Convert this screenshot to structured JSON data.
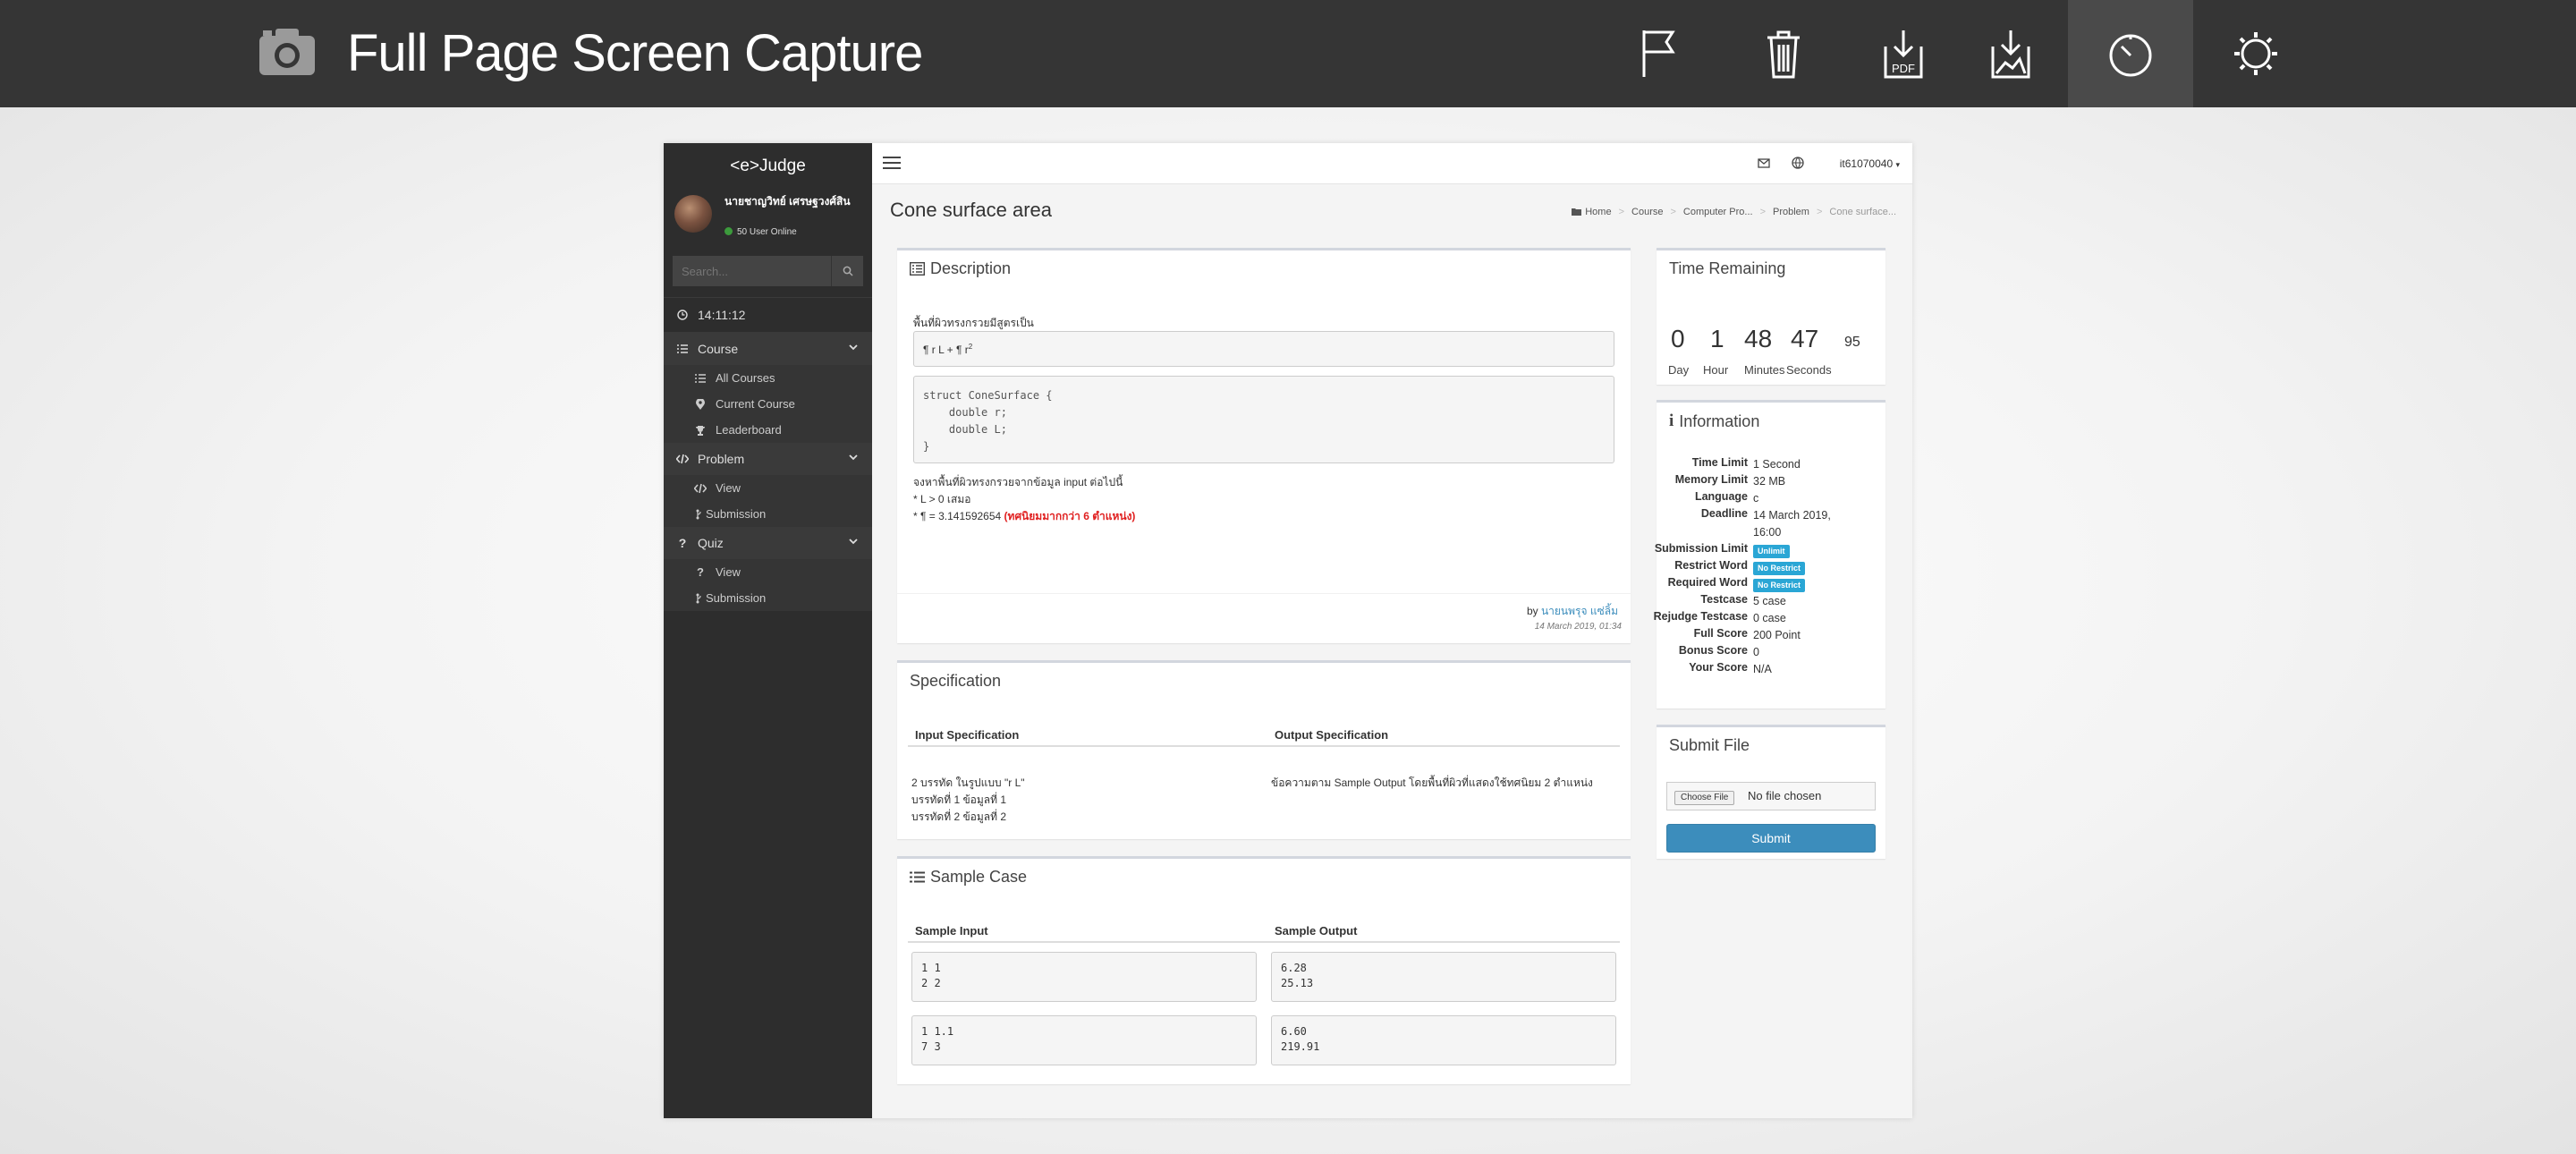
{
  "extension": {
    "title": "Full Page Screen Capture",
    "buttons": [
      "flag-icon",
      "trash-icon",
      "download-pdf-icon",
      "download-image-icon",
      "history-icon",
      "settings-icon"
    ],
    "pdf_label": "PDF"
  },
  "sidebar": {
    "brand": "<e>Judge",
    "user_name": "นายชาญวิทย์ เศรษฐวงศ์สิน",
    "online": "50 User Online",
    "search_placeholder": "Search...",
    "clock": "14:11:12",
    "sections": [
      {
        "label": "Course",
        "items": [
          "All Courses",
          "Current Course",
          "Leaderboard"
        ]
      },
      {
        "label": "Problem",
        "items": [
          "View",
          "Submission"
        ]
      },
      {
        "label": "Quiz",
        "items": [
          "View",
          "Submission"
        ]
      }
    ]
  },
  "header": {
    "user": "it61070040",
    "page_title": "Cone surface area",
    "breadcrumb": [
      "Home",
      "Course",
      "Computer Pro...",
      "Problem",
      "Cone surface..."
    ]
  },
  "description": {
    "title": "Description",
    "intro": "พื้นที่ผิวทรงกรวยมีสูตรเป็น",
    "formula": "¶ r L + ¶ r",
    "formula_sup": "2",
    "code": "struct ConeSurface {\n    double r;\n    double L;\n}",
    "note1": "จงหาพื้นที่ผิวทรงกรวยจากข้อมูล input ต่อไปนี้",
    "note2": "* L > 0 เสมอ",
    "note3": "* ¶ = 3.141592654 ",
    "note3_red": "(ทศนิยมมากกว่า 6 ตำแหน่ง)",
    "by_prefix": "by ",
    "author": "นายนพรุจ แซ่ลิ้ม",
    "date": "14 March 2019, 01:34"
  },
  "specification": {
    "title": "Specification",
    "input_header": "Input Specification",
    "output_header": "Output Specification",
    "input_line1": "2 บรรทัด ในรูปแบบ \"r L\"",
    "input_line2": "บรรทัดที่ 1 ข้อมูลที่ 1",
    "input_line3": "บรรทัดที่ 2 ข้อมูลที่ 2",
    "output_text": "ข้อความตาม Sample Output โดยพื้นที่ผิวที่แสดงใช้ทศนิยม 2 ตำแหน่ง"
  },
  "sample": {
    "title": "Sample Case",
    "input_header": "Sample Input",
    "output_header": "Sample Output",
    "cases": [
      {
        "input": "1 1\n2 2",
        "output": "6.28\n25.13"
      },
      {
        "input": "1 1.1\n7 3",
        "output": "6.60\n219.91"
      }
    ]
  },
  "timer": {
    "title": "Time Remaining",
    "day": "0",
    "hour": "1",
    "minutes": "48",
    "seconds": "47",
    "extra": "95",
    "day_label": "Day",
    "hour_label": "Hour",
    "minutes_label": "Minutes",
    "seconds_label": "Seconds"
  },
  "information": {
    "title": "Information",
    "rows": [
      {
        "k": "Time Limit",
        "v": "1 Second"
      },
      {
        "k": "Memory Limit",
        "v": "32 MB"
      },
      {
        "k": "Language",
        "v": "c"
      },
      {
        "k": "Deadline",
        "v": "14 March 2019, 16:00"
      },
      {
        "k": "Submission Limit",
        "v": "Unlimit"
      },
      {
        "k": "Restrict Word",
        "v": "No Restrict"
      },
      {
        "k": "Required Word",
        "v": "No Restrict"
      },
      {
        "k": "Testcase",
        "v": "5 case"
      },
      {
        "k": "Rejudge Testcase",
        "v": "0 case"
      },
      {
        "k": "Full Score",
        "v": "200 Point"
      },
      {
        "k": "Bonus Score",
        "v": "0"
      },
      {
        "k": "Your Score",
        "v": "N/A"
      }
    ]
  },
  "submit": {
    "title": "Submit File",
    "choose_label": "Choose File",
    "no_file": "No file chosen",
    "button": "Submit"
  },
  "colors": {
    "topbar": "#353535",
    "sidebar": "#2d2d2d",
    "accent": "#3c8dbc",
    "badge": "#2aa6d5",
    "warning_red": "#e02020"
  }
}
